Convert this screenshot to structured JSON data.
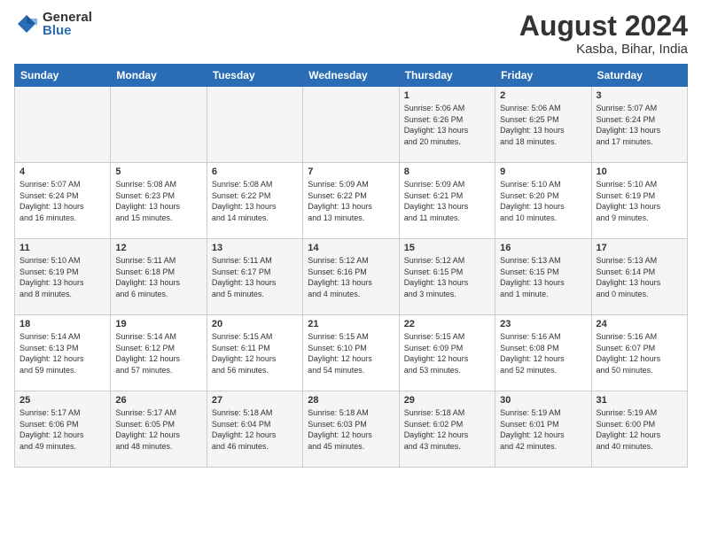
{
  "header": {
    "logo_general": "General",
    "logo_blue": "Blue",
    "month": "August 2024",
    "location": "Kasba, Bihar, India"
  },
  "weekdays": [
    "Sunday",
    "Monday",
    "Tuesday",
    "Wednesday",
    "Thursday",
    "Friday",
    "Saturday"
  ],
  "weeks": [
    [
      {
        "day": "",
        "info": ""
      },
      {
        "day": "",
        "info": ""
      },
      {
        "day": "",
        "info": ""
      },
      {
        "day": "",
        "info": ""
      },
      {
        "day": "1",
        "info": "Sunrise: 5:06 AM\nSunset: 6:26 PM\nDaylight: 13 hours\nand 20 minutes."
      },
      {
        "day": "2",
        "info": "Sunrise: 5:06 AM\nSunset: 6:25 PM\nDaylight: 13 hours\nand 18 minutes."
      },
      {
        "day": "3",
        "info": "Sunrise: 5:07 AM\nSunset: 6:24 PM\nDaylight: 13 hours\nand 17 minutes."
      }
    ],
    [
      {
        "day": "4",
        "info": "Sunrise: 5:07 AM\nSunset: 6:24 PM\nDaylight: 13 hours\nand 16 minutes."
      },
      {
        "day": "5",
        "info": "Sunrise: 5:08 AM\nSunset: 6:23 PM\nDaylight: 13 hours\nand 15 minutes."
      },
      {
        "day": "6",
        "info": "Sunrise: 5:08 AM\nSunset: 6:22 PM\nDaylight: 13 hours\nand 14 minutes."
      },
      {
        "day": "7",
        "info": "Sunrise: 5:09 AM\nSunset: 6:22 PM\nDaylight: 13 hours\nand 13 minutes."
      },
      {
        "day": "8",
        "info": "Sunrise: 5:09 AM\nSunset: 6:21 PM\nDaylight: 13 hours\nand 11 minutes."
      },
      {
        "day": "9",
        "info": "Sunrise: 5:10 AM\nSunset: 6:20 PM\nDaylight: 13 hours\nand 10 minutes."
      },
      {
        "day": "10",
        "info": "Sunrise: 5:10 AM\nSunset: 6:19 PM\nDaylight: 13 hours\nand 9 minutes."
      }
    ],
    [
      {
        "day": "11",
        "info": "Sunrise: 5:10 AM\nSunset: 6:19 PM\nDaylight: 13 hours\nand 8 minutes."
      },
      {
        "day": "12",
        "info": "Sunrise: 5:11 AM\nSunset: 6:18 PM\nDaylight: 13 hours\nand 6 minutes."
      },
      {
        "day": "13",
        "info": "Sunrise: 5:11 AM\nSunset: 6:17 PM\nDaylight: 13 hours\nand 5 minutes."
      },
      {
        "day": "14",
        "info": "Sunrise: 5:12 AM\nSunset: 6:16 PM\nDaylight: 13 hours\nand 4 minutes."
      },
      {
        "day": "15",
        "info": "Sunrise: 5:12 AM\nSunset: 6:15 PM\nDaylight: 13 hours\nand 3 minutes."
      },
      {
        "day": "16",
        "info": "Sunrise: 5:13 AM\nSunset: 6:15 PM\nDaylight: 13 hours\nand 1 minute."
      },
      {
        "day": "17",
        "info": "Sunrise: 5:13 AM\nSunset: 6:14 PM\nDaylight: 13 hours\nand 0 minutes."
      }
    ],
    [
      {
        "day": "18",
        "info": "Sunrise: 5:14 AM\nSunset: 6:13 PM\nDaylight: 12 hours\nand 59 minutes."
      },
      {
        "day": "19",
        "info": "Sunrise: 5:14 AM\nSunset: 6:12 PM\nDaylight: 12 hours\nand 57 minutes."
      },
      {
        "day": "20",
        "info": "Sunrise: 5:15 AM\nSunset: 6:11 PM\nDaylight: 12 hours\nand 56 minutes."
      },
      {
        "day": "21",
        "info": "Sunrise: 5:15 AM\nSunset: 6:10 PM\nDaylight: 12 hours\nand 54 minutes."
      },
      {
        "day": "22",
        "info": "Sunrise: 5:15 AM\nSunset: 6:09 PM\nDaylight: 12 hours\nand 53 minutes."
      },
      {
        "day": "23",
        "info": "Sunrise: 5:16 AM\nSunset: 6:08 PM\nDaylight: 12 hours\nand 52 minutes."
      },
      {
        "day": "24",
        "info": "Sunrise: 5:16 AM\nSunset: 6:07 PM\nDaylight: 12 hours\nand 50 minutes."
      }
    ],
    [
      {
        "day": "25",
        "info": "Sunrise: 5:17 AM\nSunset: 6:06 PM\nDaylight: 12 hours\nand 49 minutes."
      },
      {
        "day": "26",
        "info": "Sunrise: 5:17 AM\nSunset: 6:05 PM\nDaylight: 12 hours\nand 48 minutes."
      },
      {
        "day": "27",
        "info": "Sunrise: 5:18 AM\nSunset: 6:04 PM\nDaylight: 12 hours\nand 46 minutes."
      },
      {
        "day": "28",
        "info": "Sunrise: 5:18 AM\nSunset: 6:03 PM\nDaylight: 12 hours\nand 45 minutes."
      },
      {
        "day": "29",
        "info": "Sunrise: 5:18 AM\nSunset: 6:02 PM\nDaylight: 12 hours\nand 43 minutes."
      },
      {
        "day": "30",
        "info": "Sunrise: 5:19 AM\nSunset: 6:01 PM\nDaylight: 12 hours\nand 42 minutes."
      },
      {
        "day": "31",
        "info": "Sunrise: 5:19 AM\nSunset: 6:00 PM\nDaylight: 12 hours\nand 40 minutes."
      }
    ]
  ]
}
